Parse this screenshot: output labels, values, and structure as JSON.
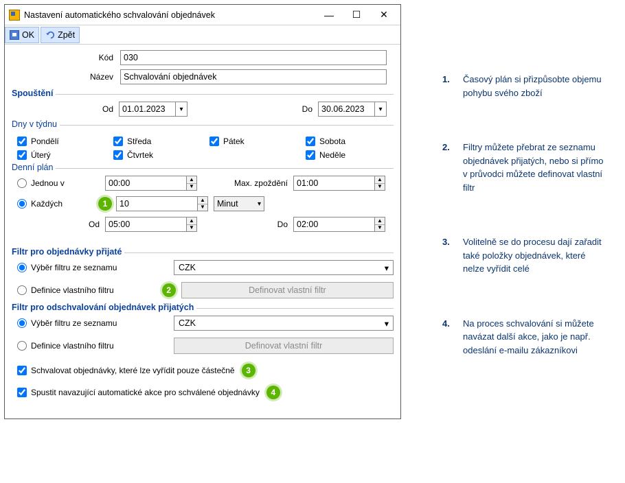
{
  "window": {
    "title": "Nastavení automatického schvalování objednávek"
  },
  "toolbar": {
    "ok": "OK",
    "back": "Zpět"
  },
  "header": {
    "code_label": "Kód",
    "code_value": "030",
    "name_label": "Název",
    "name_value": "Schvalování objednávek"
  },
  "trigger": {
    "legend": "Spouštění",
    "from_label": "Od",
    "to_label": "Do",
    "from_value": "01.01.2023",
    "to_value": "30.06.2023"
  },
  "days": {
    "legend": "Dny v týdnu",
    "mon": "Pondělí",
    "tue": "Úterý",
    "wed": "Středa",
    "thu": "Čtvrtek",
    "fri": "Pátek",
    "sat": "Sobota",
    "sun": "Neděle"
  },
  "plan": {
    "legend": "Denní plán",
    "once_label": "Jednou v",
    "once_value": "00:00",
    "maxdelay_label": "Max. zpoždění",
    "maxdelay_value": "01:00",
    "every_label": "Každých",
    "every_value": "10",
    "unit_value": "Minut",
    "from_label": "Od",
    "from_value": "05:00",
    "to_label": "Do",
    "to_value": "02:00"
  },
  "filter_in": {
    "legend": "Filtr pro objednávky přijaté",
    "opt_list": "Výběr filtru ze seznamu",
    "opt_custom": "Definice vlastního filtru",
    "list_value": "CZK",
    "def_btn": "Definovat vlastní filtr"
  },
  "filter_out": {
    "legend": "Filtr pro odschvalování objednávek přijatých",
    "opt_list": "Výběr filtru ze seznamu",
    "opt_custom": "Definice vlastního filtru",
    "list_value": "CZK",
    "def_btn": "Definovat vlastní filtr"
  },
  "bottom": {
    "partial": "Schvalovat objednávky, které lze vyřídit pouze částečně",
    "followup": "Spustit navazující automatické akce pro schválené objednávky"
  },
  "badges": {
    "b1": "1",
    "b2": "2",
    "b3": "3",
    "b4": "4"
  },
  "notes": {
    "n1": {
      "num": "1.",
      "text": "Časový plán si přizpůsobte objemu pohybu svého zboží"
    },
    "n2": {
      "num": "2.",
      "text": "Filtry můžete přebrat ze seznamu objednávek přijatých, nebo si přímo v průvodci můžete definovat vlastní filtr"
    },
    "n3": {
      "num": "3.",
      "text": "Volitelně se do procesu dají zařadit také položky objednávek, které nelze vyřídit celé"
    },
    "n4": {
      "num": "4.",
      "text": "Na proces schvalování si můžete navázat další akce, jako je např. odeslání e-mailu zákazníkovi"
    }
  }
}
